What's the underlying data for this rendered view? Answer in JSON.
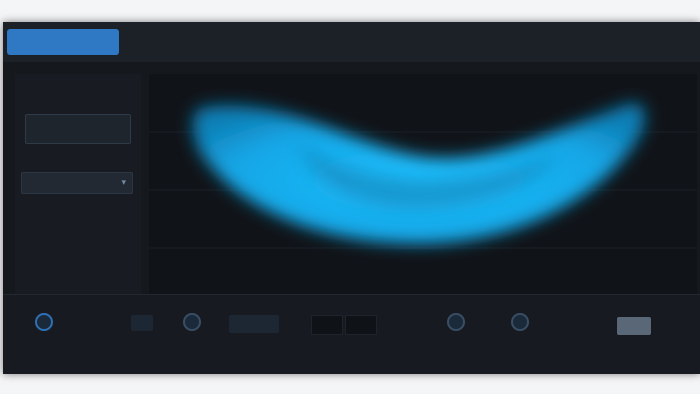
{
  "tabs": [
    {
      "label": "",
      "active": true
    },
    {
      "label": "",
      "active": false
    },
    {
      "label": "",
      "active": false
    },
    {
      "label": "",
      "active": false
    },
    {
      "label": "",
      "active": false
    },
    {
      "label": "",
      "active": false
    }
  ],
  "left_panel": {
    "top_label": "",
    "mode_button": "",
    "dropdown_value": "",
    "option_1": "",
    "option_2": ""
  },
  "bottom": {
    "controls": [
      {
        "label": ""
      },
      {
        "label": ""
      },
      {
        "label": ""
      },
      {
        "label": ""
      },
      {
        "label": ""
      },
      {
        "label": ""
      }
    ],
    "value_small": "",
    "value_box": "",
    "bypass": ""
  },
  "colors": {
    "accent": "#2e78c4",
    "curve_fill": "#18b4f0",
    "background": "#15181d"
  }
}
